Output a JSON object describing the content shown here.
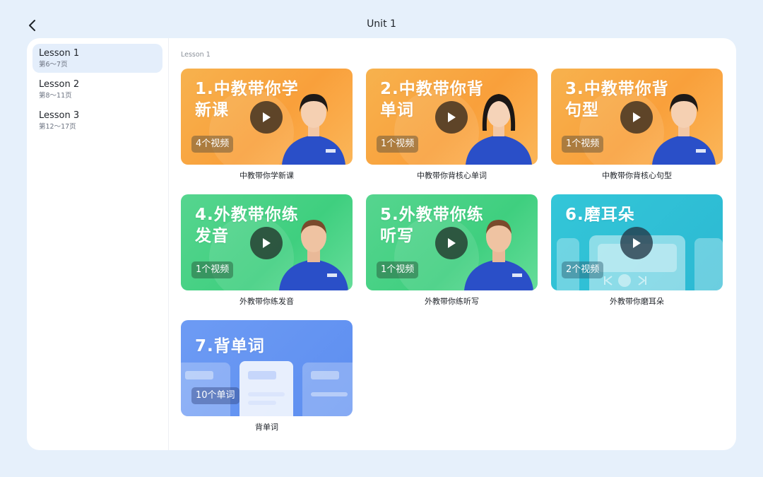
{
  "header": {
    "title": "Unit 1"
  },
  "sidebar": {
    "items": [
      {
        "name": "Lesson 1",
        "pages": "第6～7页",
        "active": true
      },
      {
        "name": "Lesson 2",
        "pages": "第8～11页",
        "active": false
      },
      {
        "name": "Lesson 3",
        "pages": "第12～17页",
        "active": false
      }
    ]
  },
  "main": {
    "section_label": "Lesson 1",
    "cards": [
      {
        "thumb_title": "1.中教带你学新课",
        "count": "4个视频",
        "caption": "中教带你学新课",
        "theme": "orange",
        "icon": "play-icon",
        "color": "#f9a03b"
      },
      {
        "thumb_title": "2.中教带你背单词",
        "count": "1个视频",
        "caption": "中教带你背核心单词",
        "theme": "orange",
        "icon": "play-icon",
        "color": "#f9a03b"
      },
      {
        "thumb_title": "3.中教带你背句型",
        "count": "1个视频",
        "caption": "中教带你背核心句型",
        "theme": "orange",
        "icon": "play-icon",
        "color": "#f9a03b"
      },
      {
        "thumb_title": "4.外教带你练发音",
        "count": "1个视频",
        "caption": "外教带你练发音",
        "theme": "green",
        "icon": "play-icon",
        "color": "#3fcf7f"
      },
      {
        "thumb_title": "5.外教带你练听写",
        "count": "1个视频",
        "caption": "外教带你练听写",
        "theme": "green",
        "icon": "play-icon",
        "color": "#3fcf7f"
      },
      {
        "thumb_title": "6.磨耳朵",
        "count": "2个视频",
        "caption": "外教带你磨耳朵",
        "theme": "teal",
        "icon": "play-icon",
        "color": "#2cb9d3"
      },
      {
        "thumb_title": "7.背单词",
        "count": "10个单词",
        "caption": "背单词",
        "theme": "blue",
        "icon": "",
        "color": "#5d8ef0"
      }
    ]
  },
  "colors": {
    "background": "#e6f0fb",
    "active_item": "#e4eefb"
  }
}
